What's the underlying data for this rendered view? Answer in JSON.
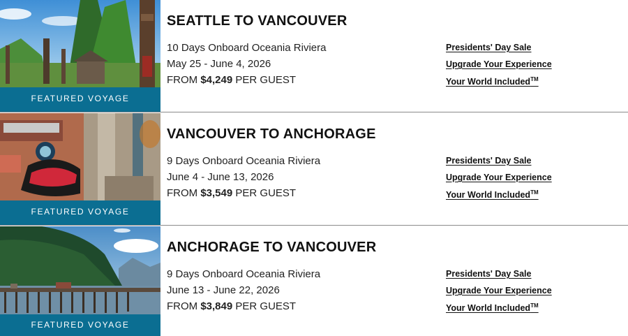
{
  "voyages": [
    {
      "title": "SEATTLE TO VANCOUVER",
      "days_ship": "10 Days Onboard Oceania Riviera",
      "dates": "May 25 - June 4, 2026",
      "price_prefix": "FROM ",
      "price": "$4,249",
      "price_suffix": " PER GUEST",
      "badge": "FEATURED VOYAGE",
      "image": "totem-poles-forest-photo",
      "links": [
        "Presidents' Day Sale",
        "Upgrade Your Experience",
        "Your World Included"
      ],
      "tm": "TM"
    },
    {
      "title": "VANCOUVER TO ANCHORAGE",
      "days_ship": "9 Days Onboard Oceania Riviera",
      "dates": "June 4 - June 13, 2026",
      "price_prefix": "FROM ",
      "price": "$3,549",
      "price_suffix": " PER GUEST",
      "badge": "FEATURED VOYAGE",
      "image": "totem-carving-closeup-photo",
      "links": [
        "Presidents' Day Sale",
        "Upgrade Your Experience",
        "Your World Included"
      ],
      "tm": "TM"
    },
    {
      "title": "ANCHORAGE TO VANCOUVER",
      "days_ship": "9 Days Onboard Oceania Riviera",
      "dates": "June 13 - June 22, 2026",
      "price_prefix": "FROM ",
      "price": "$3,849",
      "price_suffix": " PER GUEST",
      "badge": "FEATURED VOYAGE",
      "image": "pier-forest-lake-photo",
      "links": [
        "Presidents' Day Sale",
        "Upgrade Your Experience",
        "Your World Included"
      ],
      "tm": "TM"
    }
  ],
  "colors": {
    "badge_bg": "#0b6e92",
    "divider": "#8a8a8a",
    "text": "#111111"
  }
}
